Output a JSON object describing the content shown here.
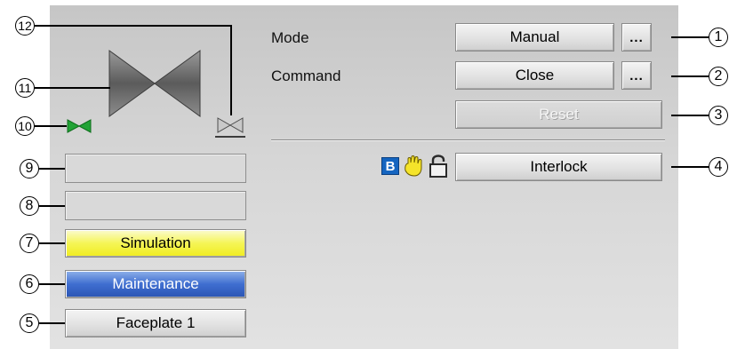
{
  "mode": {
    "label": "Mode",
    "value": "Manual",
    "more": "..."
  },
  "command": {
    "label": "Command",
    "value": "Close",
    "more": "..."
  },
  "reset": {
    "label": "Reset"
  },
  "interlock": {
    "label": "Interlock",
    "badge_letter": "B"
  },
  "status_fields": {
    "simulation": "Simulation",
    "maintenance": "Maintenance",
    "faceplate": "Faceplate 1"
  },
  "callouts": [
    "1",
    "2",
    "3",
    "4",
    "5",
    "6",
    "7",
    "8",
    "9",
    "10",
    "11",
    "12"
  ],
  "colors": {
    "simulation": "#f3ef2a",
    "maintenance": "#3a66c8",
    "valve_open_small": "#21a335",
    "lock_badge": "#1565c0"
  },
  "icons": {
    "valve": "valve-icon",
    "small_valve": "small-valve-icon",
    "hand": "hand-icon",
    "lock": "open-lock-icon"
  }
}
